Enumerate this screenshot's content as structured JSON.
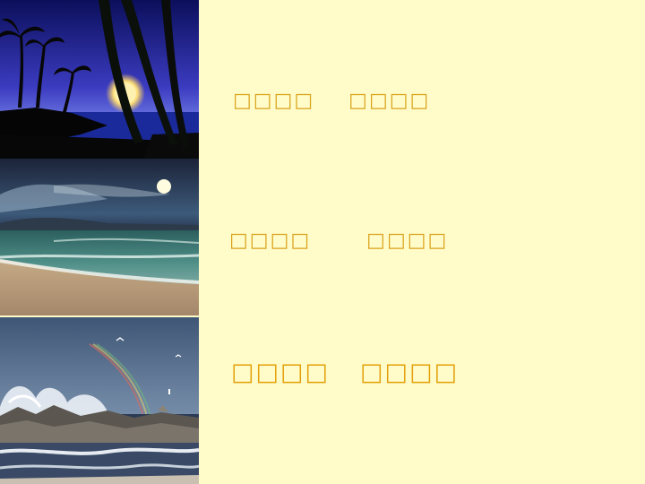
{
  "slide": {
    "lines": [
      {
        "part_a": "□□□□",
        "part_b": "□□□□"
      },
      {
        "part_a": "□□□□",
        "part_b": "□□□□"
      },
      {
        "part_a": "□□□□",
        "part_b": "□□□□"
      }
    ]
  },
  "colors": {
    "background": "#fffcc9",
    "text": "#d9a21b",
    "text_emphasis": "#e39f08"
  },
  "images": [
    {
      "name": "moonlit-palm-beach-photo"
    },
    {
      "name": "moonlit-sea-shore-photo"
    },
    {
      "name": "rocky-coast-rainbow-photo"
    }
  ]
}
